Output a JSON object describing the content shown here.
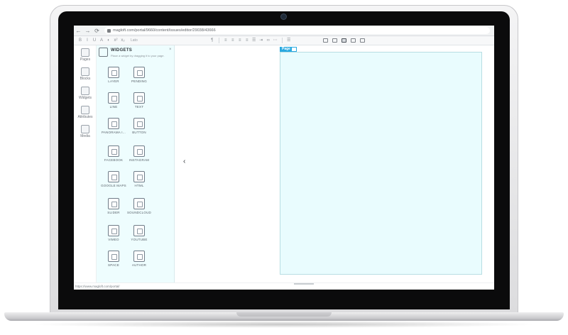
{
  "browser": {
    "url": "magloft.com/portal/9660/content/issues/editor/29038/43666"
  },
  "toolbar": {
    "text_placeholder": "Lato"
  },
  "rail": {
    "items": [
      {
        "label": "Pages",
        "icon": "pages-icon"
      },
      {
        "label": "Blocks",
        "icon": "blocks-icon"
      },
      {
        "label": "Widgets",
        "icon": "widgets-icon"
      },
      {
        "label": "Attributes",
        "icon": "attributes-icon"
      },
      {
        "label": "Media",
        "icon": "media-icon"
      }
    ]
  },
  "panel": {
    "title": "WIDGETS",
    "subtitle": "Place a widget by dragging it to your page.",
    "close": "×",
    "widgets": [
      {
        "label": "LAYER",
        "icon": "layer-icon"
      },
      {
        "label": "PENDING",
        "icon": "pending-icon"
      },
      {
        "label": "LINE",
        "icon": "line-icon"
      },
      {
        "label": "TEXT",
        "icon": "text-icon"
      },
      {
        "label": "PANORAMA I...",
        "icon": "panorama-icon"
      },
      {
        "label": "BUTTON",
        "icon": "button-icon"
      },
      {
        "label": "FACEBOOK",
        "icon": "facebook-icon"
      },
      {
        "label": "INSTAGRAM",
        "icon": "instagram-icon"
      },
      {
        "label": "GOOGLE MAPS",
        "icon": "google-maps-icon"
      },
      {
        "label": "HTML",
        "icon": "html-icon"
      },
      {
        "label": "SLIDER",
        "icon": "slider-icon"
      },
      {
        "label": "SOUNDCLOUD",
        "icon": "soundcloud-icon"
      },
      {
        "label": "VIMEO",
        "icon": "vimeo-icon"
      },
      {
        "label": "YOUTUBE",
        "icon": "youtube-icon"
      },
      {
        "label": "SPACE",
        "icon": "space-icon"
      },
      {
        "label": "AUTHOR",
        "icon": "author-icon"
      }
    ]
  },
  "canvas": {
    "page_tab": "Page"
  },
  "status": {
    "link": "https://www.magloft.com/portal/"
  },
  "colors": {
    "accent": "#29a9e0",
    "page_bg": "#e9fcfe",
    "panel_bg": "#eefdfe"
  }
}
